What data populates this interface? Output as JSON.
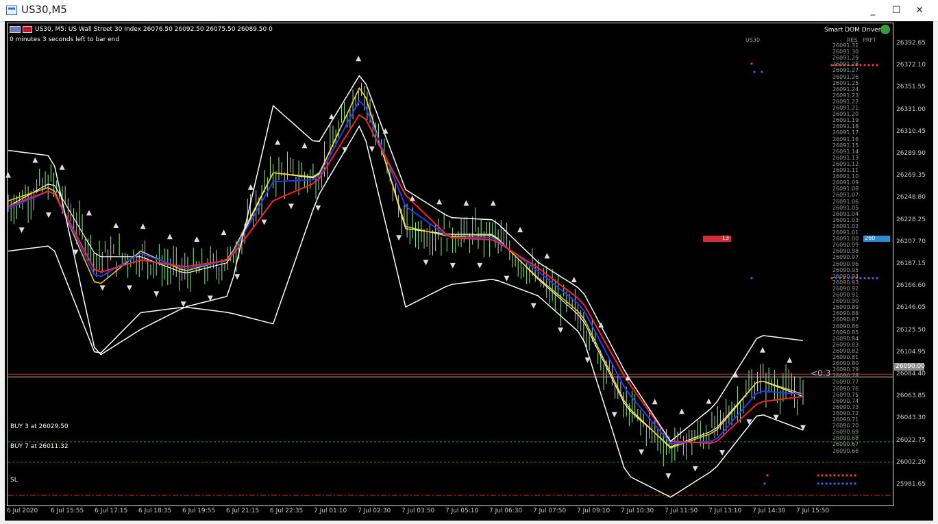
{
  "window": {
    "title": "US30,M5",
    "minimize": "_",
    "maximize": "☐",
    "close": "✕"
  },
  "header": {
    "symbol_line": "US30, M5:  US Wall Street 30 Index  26076.50 26092.50 26075.50 26089.50  0",
    "timer_line": "0 minutes 3 seconds left to bar end",
    "indicator_name": "Smart DOM Driver",
    "symbol_tag": "US30",
    "res_label": "RES",
    "prft_label": "PRFT"
  },
  "price_axis": [
    "26392.65",
    "26372.10",
    "26351.55",
    "26331.00",
    "26310.45",
    "26289.90",
    "26269.35",
    "26248.80",
    "26228.25",
    "26207.70",
    "26187.15",
    "26166.60",
    "26146.05",
    "26125.50",
    "26104.95",
    "26084.40",
    "26063.85",
    "26043.30",
    "26022.75",
    "26002.20",
    "25981.65"
  ],
  "current_price": "26090.00",
  "time_axis": [
    "6 Jul 2020",
    "6 Jul 15:55",
    "6 Jul 17:15",
    "6 Jul 18:35",
    "6 Jul 19:55",
    "6 Jul 21:15",
    "6 Jul 22:35",
    "7 Jul 01:10",
    "7 Jul 02:30",
    "7 Jul 03:50",
    "7 Jul 05:10",
    "7 Jul 06:30",
    "7 Jul 07:50",
    "7 Jul 09:10",
    "7 Jul 10:30",
    "7 Jul 11:50",
    "7 Jul 13:10",
    "7 Jul 14:30",
    "7 Jul 15:50"
  ],
  "dom_ladder": [
    "26091.31",
    "26091.30",
    "26091.29",
    "26091.28",
    "26091.27",
    "26091.26",
    "26091.25",
    "26091.24",
    "26091.23",
    "26091.22",
    "26091.21",
    "26091.20",
    "26091.19",
    "26091.18",
    "26091.17",
    "26091.16",
    "26091.15",
    "26091.14",
    "26091.13",
    "26091.12",
    "26091.11",
    "26091.10",
    "26091.09",
    "26091.08",
    "26091.07",
    "26091.06",
    "26091.05",
    "26091.04",
    "26091.03",
    "26091.02",
    "26091.01",
    "26091.00",
    "26090.99",
    "26090.98",
    "26090.97",
    "26090.96",
    "26090.95",
    "26090.94",
    "26090.93",
    "26090.92",
    "26090.91",
    "26090.90",
    "26090.89",
    "26090.88",
    "26090.87",
    "26090.86",
    "26090.85",
    "26090.84",
    "26090.83",
    "26090.82",
    "26090.81",
    "26090.80",
    "26090.79",
    "26090.78",
    "26090.77",
    "26090.76",
    "26090.75",
    "26090.74",
    "26090.73",
    "26090.72",
    "26090.71",
    "26090.70",
    "26090.69",
    "26090.68",
    "26090.67",
    "26090.66"
  ],
  "badges": {
    "sell_count": "13",
    "buy_count": "260",
    "countdown": "<0:3"
  },
  "levels": {
    "buy1": "BUY 3 at 26029.50",
    "buy2": "BUY 7 at 26011.32",
    "sl": "SL"
  },
  "colors": {
    "up": "#90ee90",
    "ma_fast": "#ffd700",
    "ma_mid": "#1e3cff",
    "ma_slow": "#ff2020",
    "bands": "#ffffff",
    "sell_badge": "#d42d3c",
    "buy_badge": "#2e8bd0"
  },
  "chart_data": {
    "type": "line",
    "ylim": [
      25975,
      26400
    ],
    "x": [
      "6 Jul 2020",
      "6 Jul 15:55",
      "6 Jul 17:15",
      "6 Jul 18:35",
      "6 Jul 19:55",
      "6 Jul 21:15",
      "6 Jul 22:35",
      "7 Jul 01:10",
      "7 Jul 02:30",
      "7 Jul 03:50",
      "7 Jul 05:10",
      "7 Jul 06:30",
      "7 Jul 07:50",
      "7 Jul 09:10",
      "7 Jul 10:30",
      "7 Jul 11:50",
      "7 Jul 13:10",
      "7 Jul 14:30",
      "7 Jul 15:50"
    ],
    "series": [
      {
        "values": [
          26240,
          26262,
          26195,
          26195,
          26180,
          26190,
          26270,
          26265,
          26350,
          26220,
          26215,
          26215,
          26175,
          26140,
          26060,
          26025,
          26040,
          26085,
          26070
        ]
      },
      {
        "values": [
          26245,
          26258,
          26168,
          26200,
          26182,
          26193,
          26270,
          26266,
          26350,
          26222,
          26213,
          26214,
          26176,
          26143,
          26062,
          26024,
          26038,
          26085,
          26072
        ]
      },
      {
        "values": [
          26238,
          26255,
          26175,
          26198,
          26184,
          26192,
          26262,
          26264,
          26338,
          26240,
          26212,
          26212,
          26182,
          26150,
          26075,
          26028,
          26030,
          26075,
          26072
        ]
      },
      {
        "values": [
          26240,
          26255,
          26180,
          26192,
          26186,
          26192,
          26245,
          26262,
          26325,
          26250,
          26212,
          26210,
          26185,
          26155,
          26085,
          26030,
          26028,
          26065,
          26070
        ]
      },
      {
        "values": [
          26290,
          26285,
          26105,
          26130,
          26150,
          26160,
          26330,
          26295,
          26360,
          26255,
          26230,
          26228,
          26190,
          26165,
          26090,
          26030,
          26062,
          26125,
          26120
        ]
      },
      {
        "values": [
          26200,
          26205,
          26105,
          26145,
          26150,
          26145,
          26135,
          26248,
          26315,
          26150,
          26170,
          26175,
          26160,
          26125,
          26000,
          25980,
          26005,
          26055,
          26040
        ]
      }
    ]
  }
}
